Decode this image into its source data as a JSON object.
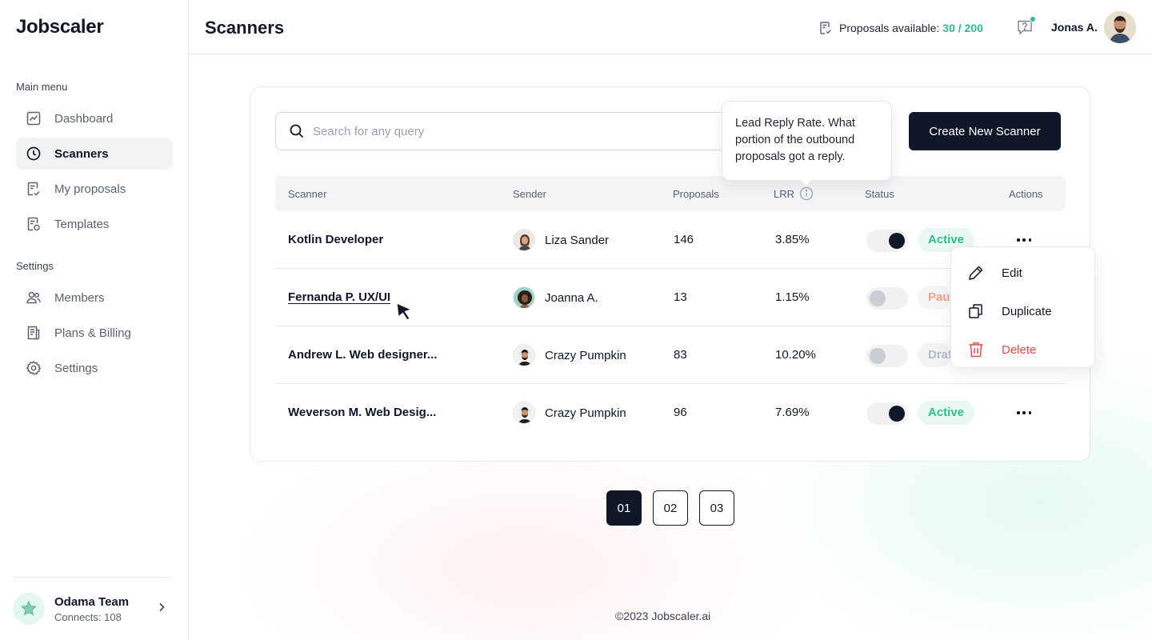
{
  "app": {
    "logo": "Jobscaler"
  },
  "sidebar": {
    "main_menu_label": "Main menu",
    "main_items": [
      {
        "label": "Dashboard",
        "icon": "chart-line-icon"
      },
      {
        "label": "Scanners",
        "icon": "clock-icon",
        "active": true
      },
      {
        "label": "My proposals",
        "icon": "proposal-doc-icon"
      },
      {
        "label": "Templates",
        "icon": "template-doc-icon"
      }
    ],
    "settings_label": "Settings",
    "settings_items": [
      {
        "label": "Members",
        "icon": "users-icon"
      },
      {
        "label": "Plans & Billing",
        "icon": "billing-doc-icon"
      },
      {
        "label": "Settings",
        "icon": "gear-icon"
      }
    ],
    "team": {
      "name": "Odama Team",
      "connects": "Connects: 108"
    }
  },
  "header": {
    "title": "Scanners",
    "proposals_label": "Proposals available:",
    "proposals_count": "30 / 200",
    "user_name": "Jonas A."
  },
  "toolbar": {
    "search_placeholder": "Search for any query",
    "create_label": "Create New Scanner"
  },
  "tooltip": {
    "text": "Lead Reply Rate. What portion of the outbound proposals got a reply."
  },
  "table": {
    "columns": [
      "Scanner",
      "Sender",
      "Proposals",
      "LRR",
      "Status",
      "Actions"
    ],
    "rows": [
      {
        "scanner": "Kotlin Developer",
        "sender": "Liza Sander",
        "proposals": "146",
        "lrr": "3.85%",
        "enabled": true,
        "status": "Active"
      },
      {
        "scanner": "Fernanda P. UX/UI",
        "sender": "Joanna A.",
        "proposals": "13",
        "lrr": "1.15%",
        "enabled": false,
        "status": "Paused"
      },
      {
        "scanner": "Andrew L. Web designer...",
        "sender": "Crazy Pumpkin",
        "proposals": "83",
        "lrr": "10.20%",
        "enabled": false,
        "status": "Draft"
      },
      {
        "scanner": "Weverson M. Web Desig...",
        "sender": "Crazy Pumpkin",
        "proposals": "96",
        "lrr": "7.69%",
        "enabled": true,
        "status": "Active"
      }
    ]
  },
  "actions_menu": [
    {
      "label": "Edit",
      "icon": "pencil-icon"
    },
    {
      "label": "Duplicate",
      "icon": "duplicate-icon"
    },
    {
      "label": "Delete",
      "icon": "trash-icon"
    }
  ],
  "pagination": {
    "pages": [
      "01",
      "02",
      "03"
    ],
    "current": "01"
  },
  "footer": {
    "text": "©2023 Jobscaler.ai"
  },
  "colors": {
    "accent": "#2cbd8f",
    "primary": "#0f1729",
    "danger": "#e5484d"
  }
}
